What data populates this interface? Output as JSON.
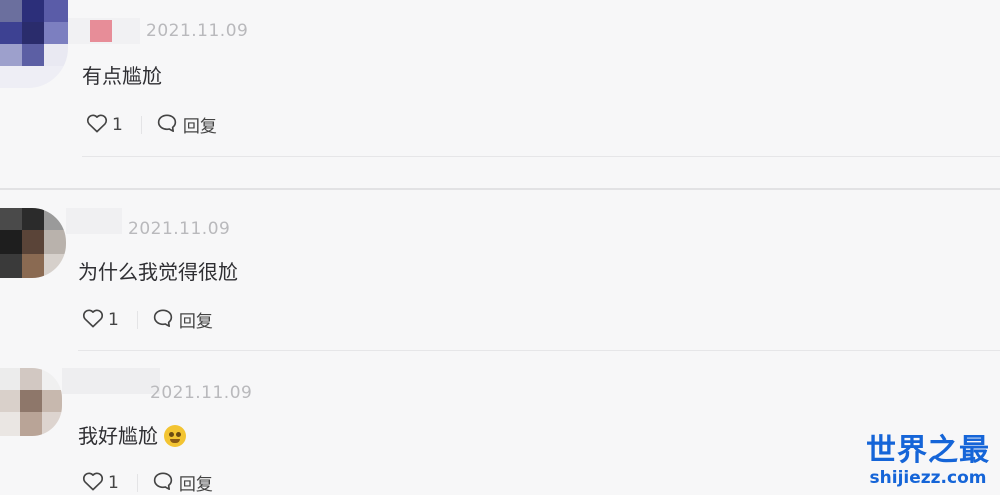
{
  "comments": [
    {
      "date": "2021.11.09",
      "text": "有点尴尬",
      "likes": "1",
      "reply_label": "回复"
    },
    {
      "date": "2021.11.09",
      "text": "为什么我觉得很尬",
      "likes": "1",
      "reply_label": "回复"
    },
    {
      "date": "2021.11.09",
      "text": "我好尴尬",
      "likes": "1",
      "reply_label": "回复",
      "emoji": "grimacing-face"
    }
  ],
  "icons": {
    "like": "heart-outline-icon",
    "reply": "speech-bubble-icon"
  },
  "watermark": {
    "title": "世界之最",
    "url": "shijiezz.com"
  },
  "colors": {
    "background": "#f7f7f8",
    "date": "#b9b9bc",
    "watermark": "#1565d8"
  }
}
